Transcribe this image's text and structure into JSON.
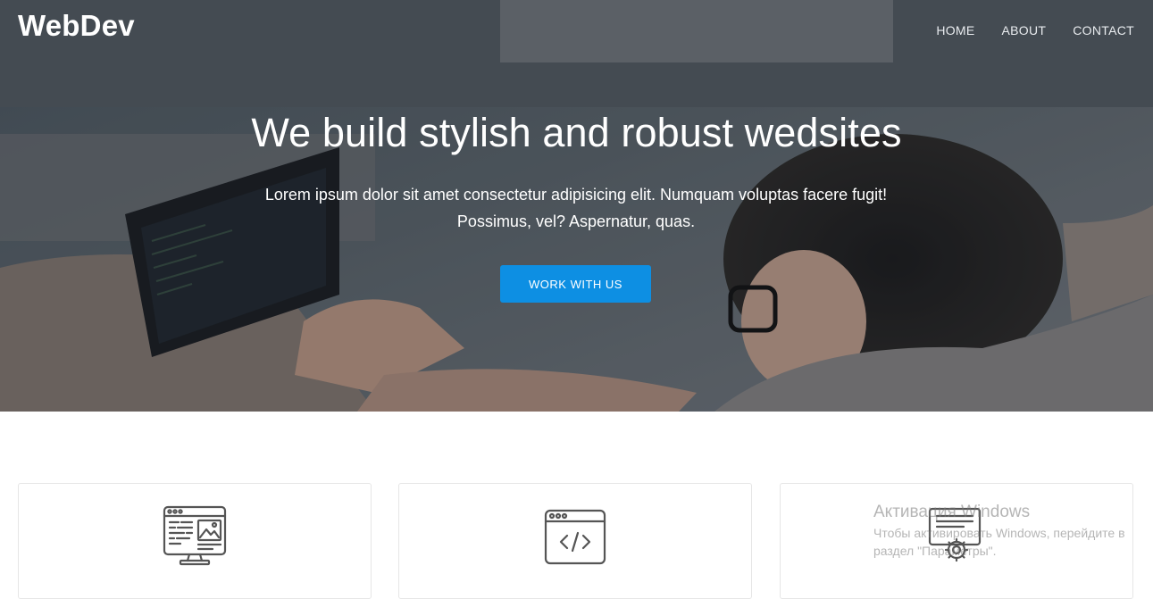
{
  "nav": {
    "brand": "WebDev",
    "links": [
      "HOME",
      "ABOUT",
      "CONTACT"
    ]
  },
  "hero": {
    "title": "We build stylish and robust wedsites",
    "subtitle_line1": "Lorem ipsum dolor sit amet consectetur adipisicing elit. Numquam voluptas facere fugit!",
    "subtitle_line2": "Possimus, vel? Aspernatur, quas.",
    "cta_label": "WORK WITH US"
  },
  "cards": [
    {
      "icon": "web-design-monitor-icon"
    },
    {
      "icon": "code-window-icon"
    },
    {
      "icon": "settings-document-icon"
    }
  ],
  "windows_watermark": {
    "title": "Активация Windows",
    "text": "Чтобы активировать Windows, перейдите в раздел \"Параметры\"."
  },
  "colors": {
    "accent": "#0d8fe3",
    "hero_overlay": "#141a20",
    "text_light": "#ffffff",
    "card_border": "#e6e6e6"
  }
}
